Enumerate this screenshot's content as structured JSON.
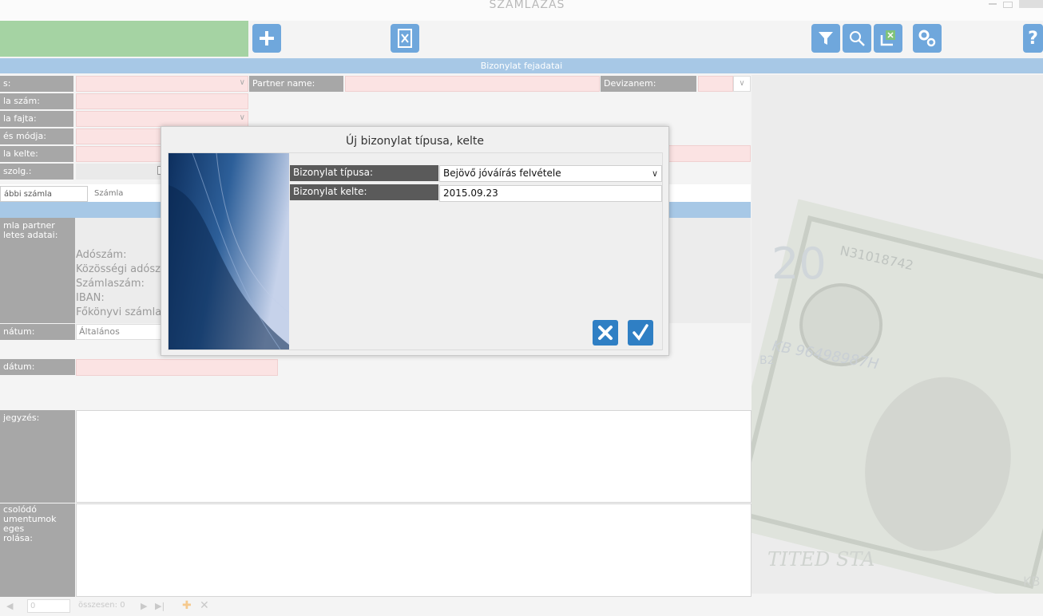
{
  "window": {
    "title": "SZÁMLÁZÁS"
  },
  "section": {
    "header": "Bizonylat fejadatai"
  },
  "form": {
    "label_type_partial": "s:",
    "label_partner": "Partner name:",
    "label_currency": "Devizanem:",
    "label_invoice_no": "la szám:",
    "label_invoice_kind": "la fajta:",
    "label_payment_mode": "és módja:",
    "label_invoice_date": "la kelte:",
    "label_service": "szolg.:"
  },
  "tabs": [
    "ábbi számla fejadatok",
    "Számla tételsorok"
  ],
  "partner_block": {
    "label": "mla partner\nletes adatai:",
    "fields": [
      "Adószám:",
      "Közösségi adószá",
      "Számlaszám:",
      "IBAN:",
      "Főkönyvi számla:"
    ],
    "format_label": "nátum:",
    "format_value": "Általános"
  },
  "lower": {
    "date_label": "dátum:",
    "note_label": "jegyzés:",
    "attach_label": "csolódó\numentumok\neges\nrolása:"
  },
  "bottom_nav": {
    "page_value": "0",
    "total_text": "összesen: 0"
  },
  "dialog": {
    "title": "Új bizonylat típusa, kelte",
    "type_label": "Bizonylat típusa:",
    "type_value": "Bejövő jóváírás felvétele",
    "date_label": "Bizonylat kelte:",
    "date_value": "2015.09.23"
  },
  "background_bill_text": {
    "serial": "N31018742",
    "denomination": "20",
    "serial2": "KB 96498987H",
    "prefix": "B2",
    "bottom": "TITED STA",
    "corner": "KB"
  },
  "colors": {
    "accent": "#6fa7dc",
    "header": "#a7c8e6",
    "green": "#a5d3a3",
    "required": "#fbe3e3",
    "ok_button": "#2f7fc4"
  },
  "icons": [
    "plus-icon",
    "excel-icon",
    "filter-icon",
    "search-icon",
    "export-icon",
    "settings-icon",
    "help-icon",
    "close-icon",
    "check-icon"
  ]
}
